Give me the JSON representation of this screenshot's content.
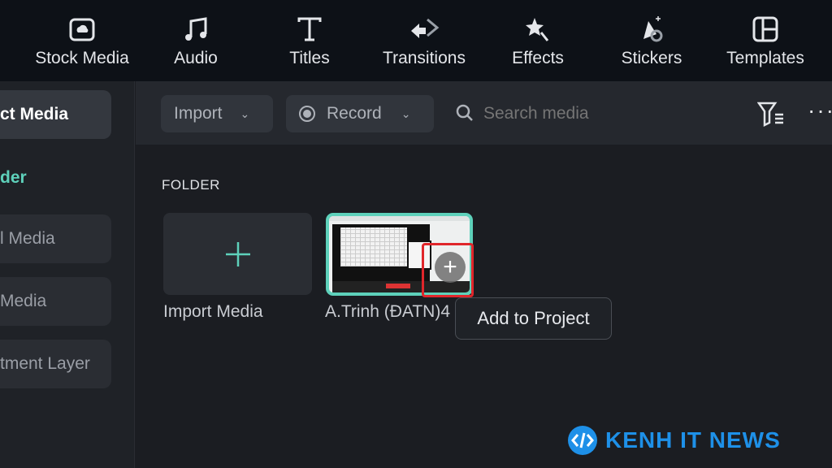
{
  "topbar": {
    "items": [
      {
        "label": "Stock Media",
        "icon": "cloud-folder-icon"
      },
      {
        "label": "Audio",
        "icon": "music-note-icon"
      },
      {
        "label": "Titles",
        "icon": "text-t-icon"
      },
      {
        "label": "Transitions",
        "icon": "transition-arrows-icon"
      },
      {
        "label": "Effects",
        "icon": "star-wand-icon"
      },
      {
        "label": "Stickers",
        "icon": "sticker-icon"
      },
      {
        "label": "Templates",
        "icon": "template-layout-icon"
      }
    ]
  },
  "sidebar": {
    "items": [
      {
        "label": "ct Media",
        "active": true
      },
      {
        "label": "der",
        "active": false
      },
      {
        "label": "l Media",
        "active": false
      },
      {
        "label": " Media",
        "active": false
      },
      {
        "label": "tment Layer",
        "active": false
      }
    ]
  },
  "toolbar": {
    "import_label": "Import",
    "record_label": "Record",
    "search_placeholder": "Search media"
  },
  "content": {
    "folder_label": "FOLDER",
    "import_media_label": "Import Media",
    "clip_name": "A.Trinh  (ĐATN)4",
    "tooltip": "Add to Project"
  },
  "watermark": {
    "text": "KENH IT NEWS"
  },
  "colors": {
    "accent": "#5ed1bb",
    "highlight": "#e0262b",
    "watermark": "#1e90e8"
  }
}
